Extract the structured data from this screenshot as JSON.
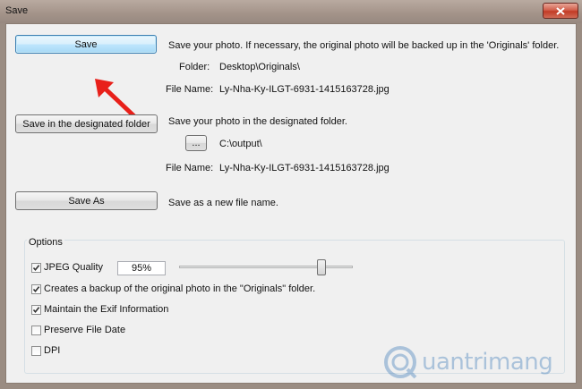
{
  "window": {
    "title": "Save"
  },
  "save_section": {
    "button_label": "Save",
    "description": "Save your photo. If necessary, the original photo will be backed up in the 'Originals' folder.",
    "folder_label": "Folder:",
    "folder_value": "Desktop\\Originals\\",
    "filename_label": "File Name:",
    "filename_value": "Ly-Nha-Ky-ILGT-6931-1415163728.jpg"
  },
  "designated_section": {
    "button_label": "Save in the designated folder",
    "description": "Save your photo in the designated folder.",
    "browse_label": "...",
    "folder_value": "C:\\output\\",
    "filename_label": "File Name:",
    "filename_value": "Ly-Nha-Ky-ILGT-6931-1415163728.jpg"
  },
  "save_as_section": {
    "button_label": "Save As",
    "description": "Save as a new file name."
  },
  "options": {
    "group_label": "Options",
    "jpeg_quality": {
      "label": "JPEG Quality",
      "checked": true,
      "value": "95%",
      "slider_percent": 95
    },
    "backup": {
      "label": "Creates a backup of the original photo in the \"Originals\" folder.",
      "checked": true
    },
    "exif": {
      "label": "Maintain the Exif Information",
      "checked": true
    },
    "preserve_date": {
      "label": "Preserve File Date",
      "checked": false
    },
    "dpi": {
      "label": "DPI",
      "checked": false
    }
  },
  "watermark": {
    "text": "uantrimang",
    "icon": "quantrimang-logo"
  },
  "colors": {
    "default_button_border": "#3c7fb1",
    "arrow": "#e8201a",
    "close_button": "#c23b26"
  }
}
